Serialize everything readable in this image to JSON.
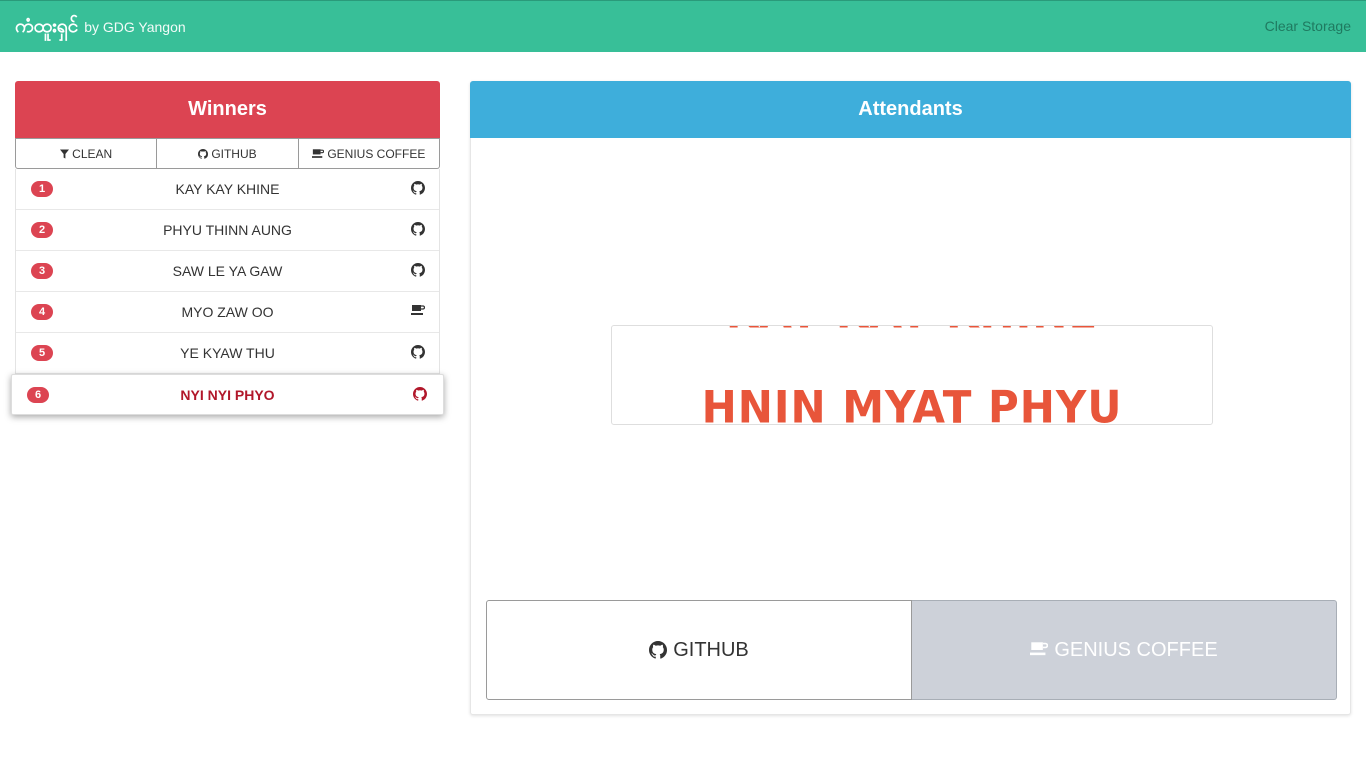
{
  "navbar": {
    "brand_main": "ကံထူးရှင်",
    "brand_sub": "by GDG Yangon",
    "clear_label": "Clear Storage"
  },
  "winners": {
    "title": "Winners",
    "filters": [
      {
        "label": "CLEAN",
        "icon": "filter-icon"
      },
      {
        "label": "GITHUB",
        "icon": "github-icon"
      },
      {
        "label": "GENIUS COFFEE",
        "icon": "coffee-icon"
      }
    ],
    "items": [
      {
        "rank": "1",
        "name": "KAY KAY KHINE",
        "icon": "github-icon"
      },
      {
        "rank": "2",
        "name": "PHYU THINN AUNG",
        "icon": "github-icon"
      },
      {
        "rank": "3",
        "name": "SAW LE YA GAW",
        "icon": "github-icon"
      },
      {
        "rank": "4",
        "name": "MYO ZAW OO",
        "icon": "coffee-icon"
      },
      {
        "rank": "5",
        "name": "YE KYAW THU",
        "icon": "github-icon"
      },
      {
        "rank": "6",
        "name": "NYI NYI PHYO",
        "icon": "github-icon",
        "active": true
      }
    ]
  },
  "attendants": {
    "title": "Attendants",
    "slot_current": "HNIN MYAT PHYU",
    "buttons": {
      "github_label": "GITHUB",
      "coffee_label": "GENIUS COFFEE"
    }
  },
  "colors": {
    "navbar": "#38bf98",
    "winners_header": "#dc4452",
    "attendants_header": "#3eaedb",
    "slot_text": "#e8553a"
  }
}
